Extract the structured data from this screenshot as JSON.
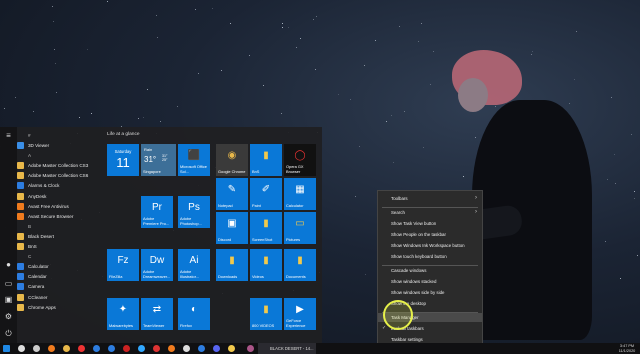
{
  "start_menu": {
    "tiles_header": "Life at a glance",
    "app_list": [
      {
        "label": "#",
        "letter": true
      },
      {
        "label": "3D Viewer",
        "color": "#3a8ee6"
      },
      {
        "label": "A",
        "letter": true
      },
      {
        "label": "Adobe Master Collection CS3",
        "color": "#e8b84a"
      },
      {
        "label": "Adobe Master Collection CS6",
        "color": "#e8b84a"
      },
      {
        "label": "Alarms & Clock",
        "color": "#2d7de0"
      },
      {
        "label": "AnyDesk",
        "color": "#e8b84a"
      },
      {
        "label": "Avast Free Antivirus",
        "color": "#f07b1e"
      },
      {
        "label": "Avast Secure Browser",
        "color": "#f07b1e"
      },
      {
        "label": "B",
        "letter": true
      },
      {
        "label": "Black Desert",
        "color": "#e8b84a"
      },
      {
        "label": "BnS",
        "color": "#e8b84a"
      },
      {
        "label": "C",
        "letter": true
      },
      {
        "label": "Calculator",
        "color": "#2d7de0"
      },
      {
        "label": "Calendar",
        "color": "#2d7de0"
      },
      {
        "label": "Camera",
        "color": "#2d7de0"
      },
      {
        "label": "CCleaner",
        "color": "#e8b84a"
      },
      {
        "label": "Chrome Apps",
        "color": "#e8b84a"
      }
    ],
    "tiles": [
      {
        "label": "",
        "icon": "📅",
        "kind": "calendar-tile"
      },
      {
        "label": "Singapore",
        "icon": "☁",
        "kind": "weather-tile"
      },
      {
        "label": "Microsoft Office Sol...",
        "icon": "⬛",
        "kind": "office-tile"
      },
      {
        "label": "Google Chrome",
        "icon": "◉",
        "kind": "chrome-tile"
      },
      {
        "label": "BnS",
        "icon": "▮",
        "kind": "bns-tile"
      },
      {
        "label": "Opera GX Browser",
        "icon": "◯",
        "kind": "opera-tile"
      },
      {
        "label": "Notepad",
        "icon": "✎",
        "kind": "notepad-tile"
      },
      {
        "label": "Paint",
        "icon": "✐",
        "kind": "paint-tile"
      },
      {
        "label": "Calculator",
        "icon": "▦",
        "kind": "calculator-tile"
      },
      {
        "label": "Adobe Premiere Pro...",
        "icon": "Pr",
        "kind": "premiere-tile"
      },
      {
        "label": "Adobe Photoshop...",
        "icon": "Ps",
        "kind": "photoshop-tile"
      },
      {
        "label": "Discord",
        "icon": "▣",
        "kind": "discord-tile"
      },
      {
        "label": "ScreenShot",
        "icon": "▮",
        "kind": "screenshot-tile"
      },
      {
        "label": "Pictures",
        "icon": "▭",
        "kind": "pictures-tile"
      },
      {
        "label": "FileZilla",
        "icon": "Fz",
        "kind": "filezilla-tile"
      },
      {
        "label": "Adobe Dreamweaver...",
        "icon": "Dw",
        "kind": "dreamweaver-tile"
      },
      {
        "label": "Adobe Illustrator...",
        "icon": "Ai",
        "kind": "illustrator-tile"
      },
      {
        "label": "Downloads",
        "icon": "▮",
        "kind": "downloads-tile"
      },
      {
        "label": "Videos",
        "icon": "▮",
        "kind": "videos-tile"
      },
      {
        "label": "Documents",
        "icon": "▮",
        "kind": "documents-tile"
      },
      {
        "label": "Malwarebytes",
        "icon": "✦",
        "kind": "malwarebytes-tile"
      },
      {
        "label": "TeamViewer",
        "icon": "⇄",
        "kind": "teamviewer-tile"
      },
      {
        "label": "Firefox",
        "icon": "◐",
        "kind": "firefox-tile"
      },
      {
        "label": "800 VIDEOS",
        "icon": "▮",
        "kind": "videos800-tile"
      },
      {
        "label": "GeForce Experience",
        "icon": "▶",
        "kind": "geforce-tile"
      }
    ],
    "calendar": {
      "day_name": "Saturday",
      "day_num": "11"
    },
    "weather": {
      "condition": "Rain",
      "temp": "31°",
      "hi_lo": "31°\n25°",
      "city": "Singapore"
    }
  },
  "context_menu": {
    "items": [
      {
        "label": "Toolbars",
        "submenu": true
      },
      {
        "label": "Search",
        "submenu": true
      },
      {
        "label": "Show Task View button"
      },
      {
        "label": "Show People on the taskbar"
      },
      {
        "label": "Show Windows Ink Workspace button"
      },
      {
        "label": "Show touch keyboard button"
      },
      {
        "label": "Cascade windows"
      },
      {
        "label": "Show windows stacked"
      },
      {
        "label": "Show windows side by side"
      },
      {
        "label": "Show the desktop"
      },
      {
        "label": "Task Manager",
        "highlighted": true
      },
      {
        "label": "Lock all taskbars",
        "checked": true
      },
      {
        "label": "Taskbar settings"
      }
    ]
  },
  "taskbar": {
    "active_window": "BLACK DESERT - 14...",
    "time": "3:47 PM",
    "date": "11/1/2020"
  },
  "colors": {
    "tile_blue": "#0a78d7",
    "accent_yellow": "#e6f04a"
  }
}
